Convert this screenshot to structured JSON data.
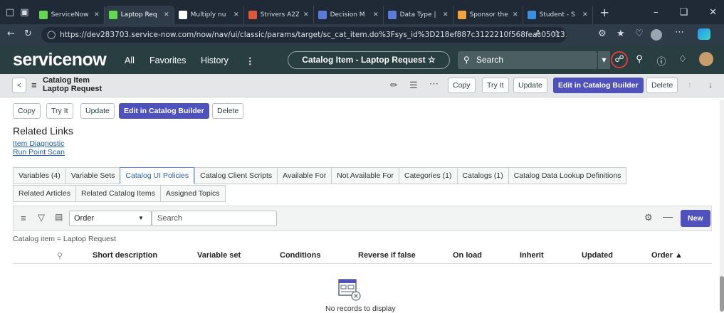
{
  "browser": {
    "tabs": [
      {
        "label": "ServiceNow",
        "fav_color": "#62d84e"
      },
      {
        "label": "Laptop Req",
        "fav_color": "#62d84e",
        "active": true
      },
      {
        "label": "Multiply nu",
        "fav_color": "#ffffff"
      },
      {
        "label": "Strivers A2Z",
        "fav_color": "#e0583a"
      },
      {
        "label": "Decision M",
        "fav_color": "#5a7cd8"
      },
      {
        "label": "Data Type |",
        "fav_color": "#5a7cd8"
      },
      {
        "label": "Sponsor the",
        "fav_color": "#f2a33c"
      },
      {
        "label": "Student - S",
        "fav_color": "#3a8fe0"
      }
    ],
    "url": "https://dev283703.service-now.com/now/nav/ui/classic/params/target/sc_cat_item.do%3Fsys_id%3D218ef887c3122210f568feac050131ec..."
  },
  "header": {
    "logo": "servicenow",
    "nav": [
      "All",
      "Favorites",
      "History"
    ],
    "context_pill": "Catalog Item - Laptop Request ☆",
    "search_placeholder": "Search"
  },
  "form": {
    "type_label": "Catalog Item",
    "record_label": "Laptop Request",
    "buttons": {
      "copy": "Copy",
      "try_it": "Try It",
      "update": "Update",
      "builder": "Edit in Catalog Builder",
      "delete": "Delete"
    }
  },
  "related_links": {
    "title": "Related Links",
    "links": [
      "Item Diagnostic",
      "Run Point Scan"
    ]
  },
  "related_tabs": {
    "row1": [
      "Variables (4)",
      "Variable Sets",
      "Catalog UI Policies",
      "Catalog Client Scripts",
      "Available For",
      "Not Available For",
      "Categories (1)",
      "Catalogs (1)",
      "Catalog Data Lookup Definitions"
    ],
    "row2": [
      "Related Articles",
      "Related Catalog Items",
      "Assigned Topics"
    ],
    "selected": "Catalog UI Policies"
  },
  "list": {
    "field_select": "Order",
    "search_placeholder": "Search",
    "new_label": "New",
    "filter_breadcrumb": "Catalog item = Laptop Request",
    "columns": [
      "Short description",
      "Variable set",
      "Conditions",
      "Reverse if false",
      "On load",
      "Inherit",
      "Updated",
      "Order ▲"
    ],
    "empty_message": "No records to display"
  },
  "colors": {
    "brand_dark": "#293e40",
    "primary_button": "#4f52bd",
    "link": "#1f5ea8"
  }
}
